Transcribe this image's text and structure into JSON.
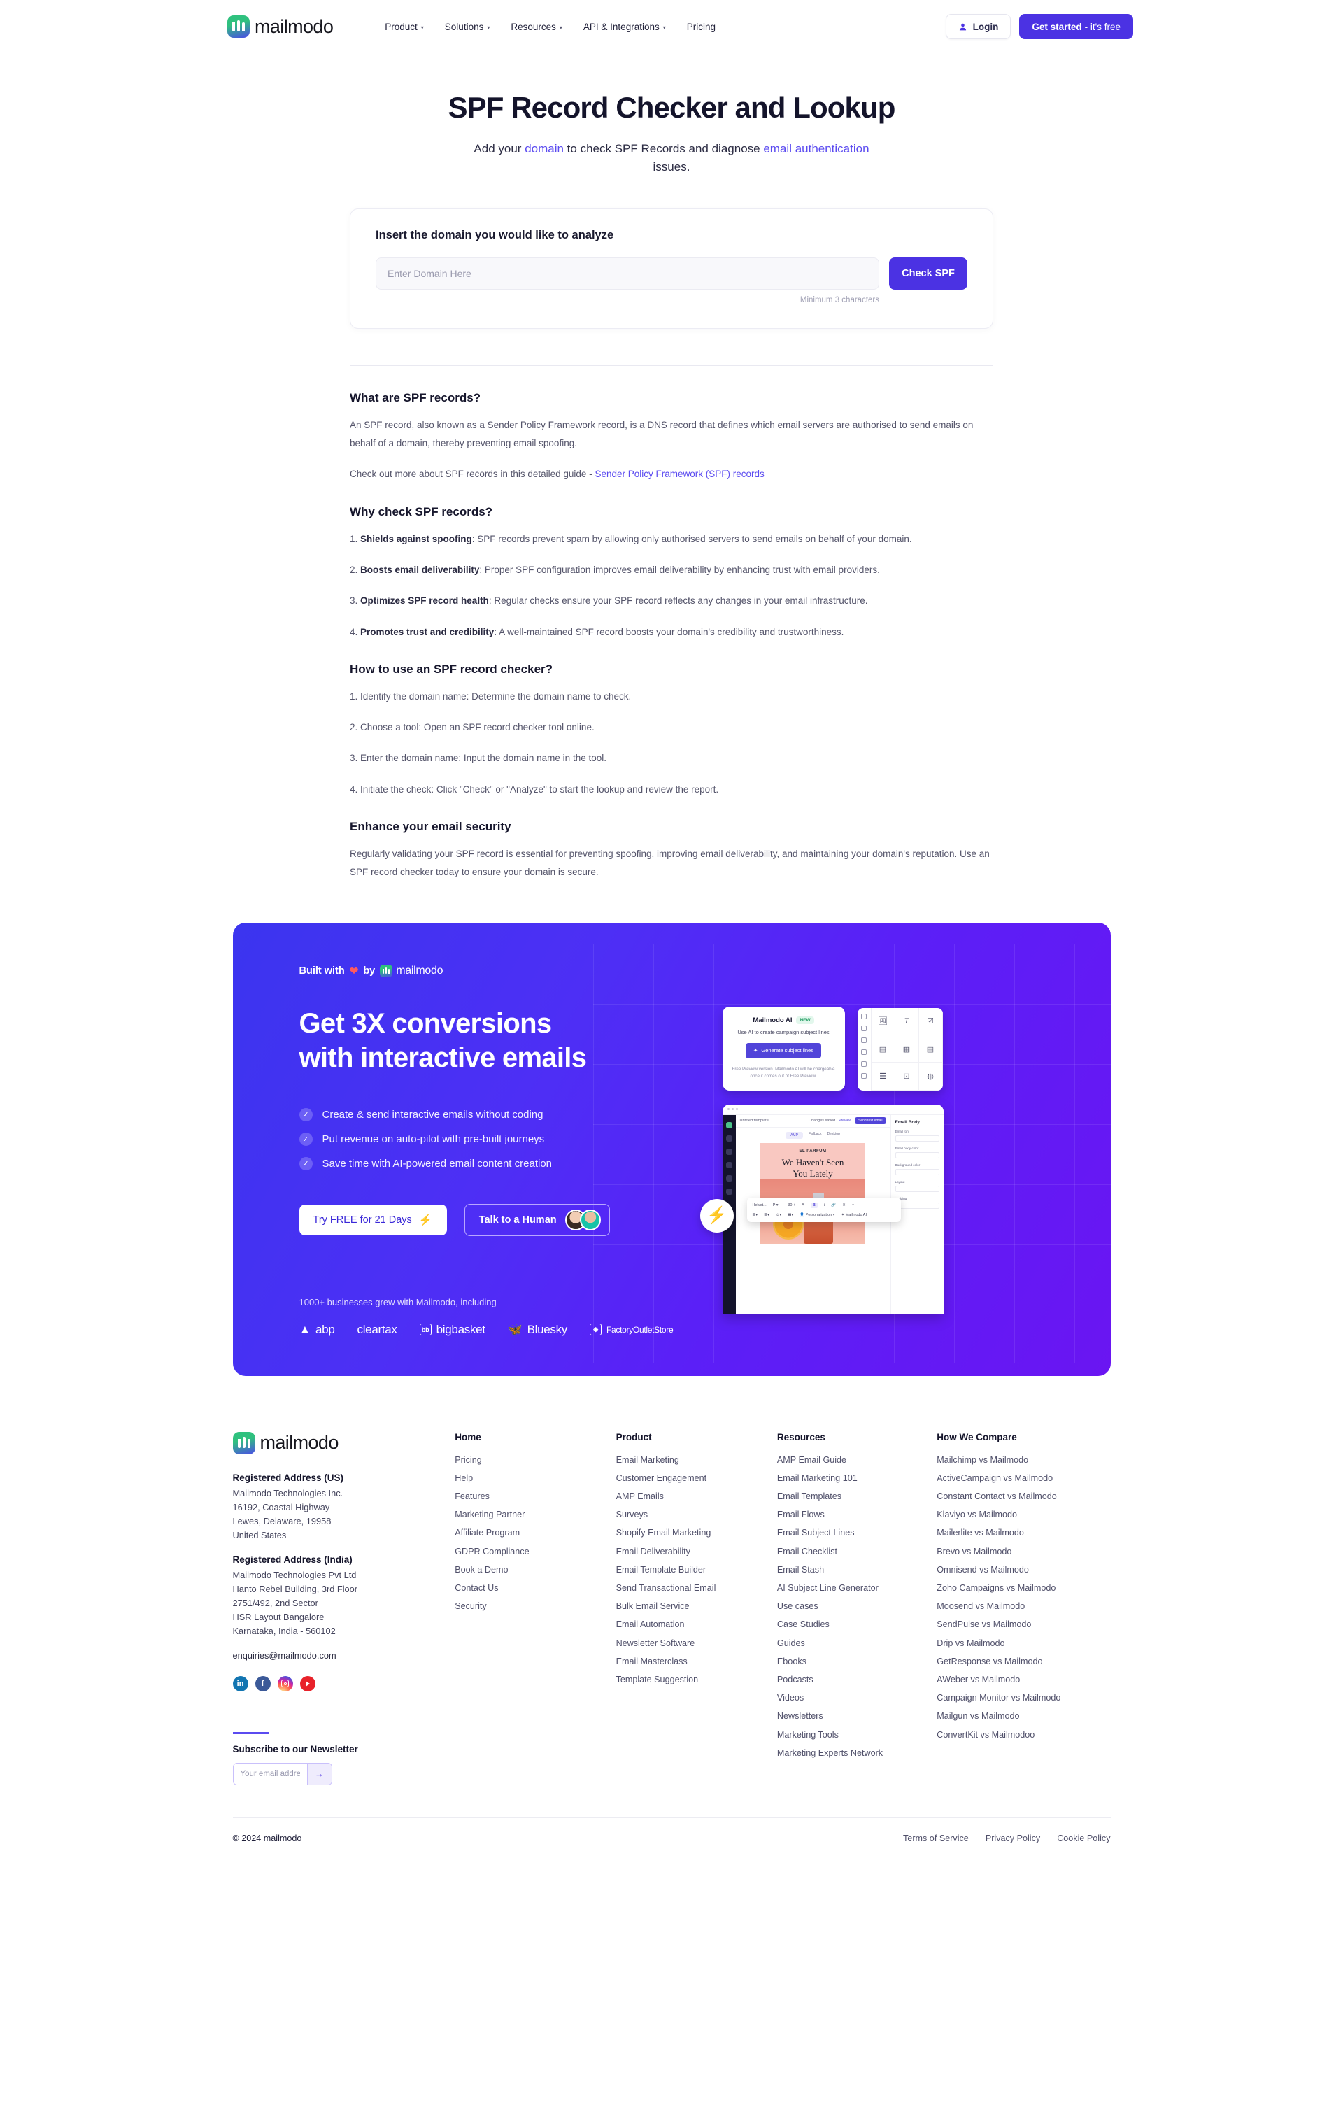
{
  "brand": {
    "name": "mailmodo"
  },
  "header": {
    "nav": [
      {
        "label": "Product",
        "has_caret": true
      },
      {
        "label": "Solutions",
        "has_caret": true
      },
      {
        "label": "Resources",
        "has_caret": true
      },
      {
        "label": "API & Integrations",
        "has_caret": true
      },
      {
        "label": "Pricing",
        "has_caret": false
      }
    ],
    "login_label": "Login",
    "cta_strong": "Get started",
    "cta_rest": "- it's free"
  },
  "hero": {
    "title": "SPF Record Checker and Lookup",
    "sub_1": "Add your ",
    "sub_link_1": "domain",
    "sub_2": " to check SPF Records and diagnose ",
    "sub_link_2": "email authentication",
    "sub_3": " issues."
  },
  "search": {
    "label": "Insert the domain you would like to analyze",
    "placeholder": "Enter Domain Here",
    "value": "",
    "button": "Check SPF",
    "hint": "Minimum 3 characters"
  },
  "article": {
    "h1": "What are SPF records?",
    "p1": "An SPF record, also known as a Sender Policy Framework record, is a DNS record that defines which email servers are authorised to send emails on behalf of a domain, thereby preventing email spoofing.",
    "p2_pre": "Check out more about SPF records in this detailed guide - ",
    "p2_link": "Sender Policy Framework (SPF) records",
    "h2": "Why check SPF records?",
    "why": [
      {
        "num": "1. ",
        "bold": "Shields against spoofing",
        "rest": ": SPF records prevent spam by allowing only authorised servers to send emails on behalf of your domain."
      },
      {
        "num": "2. ",
        "bold": "Boosts email deliverability",
        "rest": ": Proper SPF configuration improves email deliverability by enhancing trust with email providers."
      },
      {
        "num": "3. ",
        "bold": "Optimizes SPF record health",
        "rest": ": Regular checks ensure your SPF record reflects any changes in your email infrastructure."
      },
      {
        "num": "4. ",
        "bold": "Promotes trust and credibility",
        "rest": ": A well-maintained SPF record boosts your domain's credibility and trustworthiness."
      }
    ],
    "h3": "How to use an SPF record checker?",
    "how": [
      "1. Identify the domain name: Determine the domain name to check.",
      "2. Choose a tool: Open an SPF record checker tool online.",
      "3. Enter the domain name: Input the domain name in the tool.",
      "4. Initiate the check: Click \"Check\" or \"Analyze\" to start the lookup and review the report."
    ],
    "h4": "Enhance your email security",
    "p_last": "Regularly validating your SPF record is essential for preventing spoofing, improving email deliverability, and maintaining your domain's reputation. Use an SPF record checker today to ensure your domain is secure."
  },
  "promo": {
    "built_with": "Built with",
    "built_by": "by",
    "built_brand": "mailmodo",
    "heading_line1": "Get 3X conversions",
    "heading_line2": "with interactive emails",
    "features": [
      "Create & send interactive emails without coding",
      "Put revenue on auto-pilot with pre-built journeys",
      "Save time with AI-powered email content creation"
    ],
    "btn_trial": "Try FREE for 21 Days",
    "btn_talk": "Talk to a Human",
    "social_proof": "1000+ businesses grew with Mailmodo, including",
    "brands": [
      "abp",
      "cleartax",
      "bigbasket",
      "Bluesky",
      "FactoryOutletStore"
    ],
    "mock": {
      "ai_title": "Mailmodo AI",
      "ai_badge": "NEW",
      "ai_sub": "Use AI to create campaign subject lines",
      "ai_button": "Generate subject lines",
      "ai_note": "Free Preview version. Mailmodo AI will be chargeable once it comes out of Free Preview.",
      "editor_template_name": "Untitled template",
      "editor_saved": "Changes saved",
      "editor_preview": "Preview",
      "editor_send": "Send test email",
      "tab_amp": "AMP",
      "tab_fallback": "Fallback",
      "tab_desktop": "Desktop",
      "email_brand": "EL PARFUM",
      "email_head_l1": "We Haven't Seen",
      "email_head_l2": "You Lately",
      "panel_title": "Email Body",
      "panel_font_label": "Email font",
      "panel_body_color": "Email body color",
      "panel_bg_color": "Background color",
      "panel_layout": "Layout",
      "panel_padding": "Padding",
      "toolbar_font": "Helvet...",
      "toolbar_size": "30",
      "toolbar_personalization": "Personalization",
      "toolbar_ai": "Mailmodo AI"
    }
  },
  "footer": {
    "address_us_head": "Registered Address (US)",
    "address_us": "Mailmodo Technologies Inc.\n16192, Coastal Highway\nLewes, Delaware, 19958\nUnited States",
    "address_in_head": "Registered Address (India)",
    "address_in": "Mailmodo Technologies Pvt Ltd\nHanto Rebel Building, 3rd Floor\n2751/492, 2nd Sector\nHSR Layout Bangalore\nKarnataka, India - 560102",
    "email": "enquiries@mailmodo.com",
    "socials": [
      "linkedin-icon",
      "facebook-icon",
      "instagram-icon",
      "youtube-icon"
    ],
    "newsletter_title": "Subscribe to our Newsletter",
    "newsletter_placeholder": "Your email address",
    "newsletter_value": "",
    "columns": [
      {
        "head": "Home",
        "links": [
          "Pricing",
          "Help",
          "Features",
          "Marketing Partner",
          "Affiliate Program",
          "GDPR Compliance",
          "Book a Demo",
          "Contact Us",
          "Security"
        ]
      },
      {
        "head": "Product",
        "links": [
          "Email Marketing",
          "Customer Engagement",
          "AMP Emails",
          "Surveys",
          "Shopify Email Marketing",
          "Email Deliverability",
          "Email Template Builder",
          "Send Transactional Email",
          "Bulk Email Service",
          "Email Automation",
          "Newsletter Software",
          "Email Masterclass",
          "Template Suggestion"
        ]
      },
      {
        "head": "Resources",
        "links": [
          "AMP Email Guide",
          "Email Marketing 101",
          "Email Templates",
          "Email Flows",
          "Email Subject Lines",
          "Email Checklist",
          "Email Stash",
          "AI Subject Line Generator",
          "Use cases",
          "Case Studies",
          "Guides",
          "Ebooks",
          "Podcasts",
          "Videos",
          "Newsletters",
          "Marketing Tools",
          "Marketing Experts Network"
        ]
      },
      {
        "head": "How We Compare",
        "links": [
          "Mailchimp vs Mailmodo",
          "ActiveCampaign vs Mailmodo",
          "Constant Contact vs Mailmodo",
          "Klaviyo vs Mailmodo",
          "Mailerlite vs Mailmodo",
          "Brevo vs Mailmodo",
          "Omnisend vs Mailmodo",
          "Zoho Campaigns vs Mailmodo",
          "Moosend vs Mailmodo",
          "SendPulse vs Mailmodo",
          "Drip vs Mailmodo",
          "GetResponse vs Mailmodo",
          "AWeber vs Mailmodo",
          "Campaign Monitor vs Mailmodo",
          "Mailgun vs Mailmodo",
          "ConvertKit vs Mailmodoo"
        ]
      }
    ],
    "copyright": "© 2024 mailmodo",
    "legal": [
      "Terms of Service",
      "Privacy Policy",
      "Cookie Policy"
    ]
  },
  "colors": {
    "accent": "#4b32e3",
    "link": "#5b4bf0",
    "promo_start": "#3b35ef",
    "promo_end": "#6a15f2"
  }
}
